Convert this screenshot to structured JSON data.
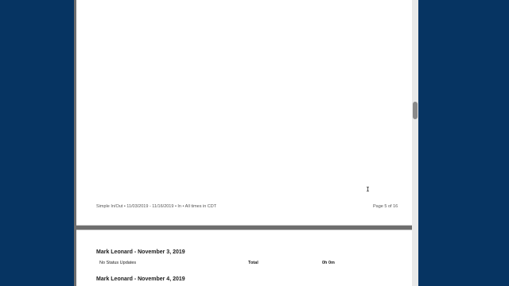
{
  "report": {
    "footer_left": "Simple In/Out • 11/03/2019 - 11/16/2019 • In • All times in CDT",
    "footer_right": "Page 5 of 16",
    "cursor_glyph": "I",
    "days": [
      {
        "heading": "Mark Leonard - November 3, 2019",
        "status": "No Status Updates",
        "total_label": "Total",
        "total_value": "0h 0m"
      },
      {
        "heading": "Mark Leonard - November 4, 2019"
      }
    ]
  }
}
